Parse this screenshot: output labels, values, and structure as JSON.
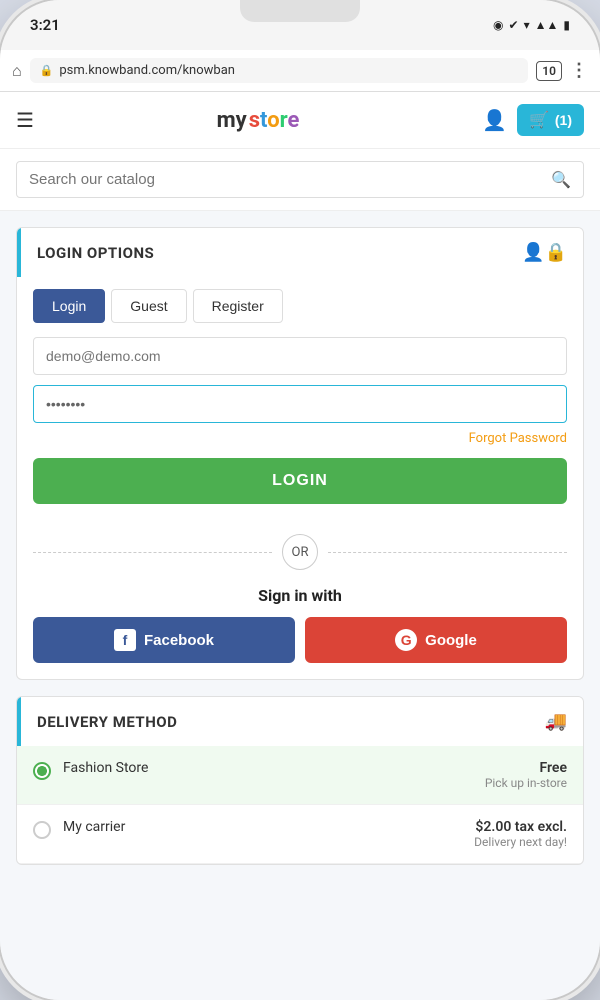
{
  "status_bar": {
    "time": "3:21",
    "icons": "▾ ◂ ▮"
  },
  "browser": {
    "url": "psm.knowband.com/knowban",
    "tab_count": "10"
  },
  "header": {
    "logo": "my store",
    "cart_label": "(1)"
  },
  "search": {
    "placeholder": "Search our catalog"
  },
  "login_section": {
    "title": "LOGIN OPTIONS",
    "tabs": [
      "Login",
      "Guest",
      "Register"
    ],
    "active_tab": 0,
    "email_placeholder": "demo@demo.com",
    "password_value": "••••••••",
    "forgot_label": "Forgot Password",
    "login_btn": "LOGIN",
    "or_label": "OR",
    "sign_in_with": "Sign in with",
    "facebook_label": "Facebook",
    "google_label": "Google"
  },
  "delivery_section": {
    "title": "DELIVERY METHOD",
    "options": [
      {
        "name": "Fashion Store",
        "price": "Free",
        "sub": "Pick up in-store",
        "selected": true
      },
      {
        "name": "My carrier",
        "price": "$2.00 tax excl.",
        "sub": "Delivery next day!",
        "selected": false
      }
    ]
  }
}
